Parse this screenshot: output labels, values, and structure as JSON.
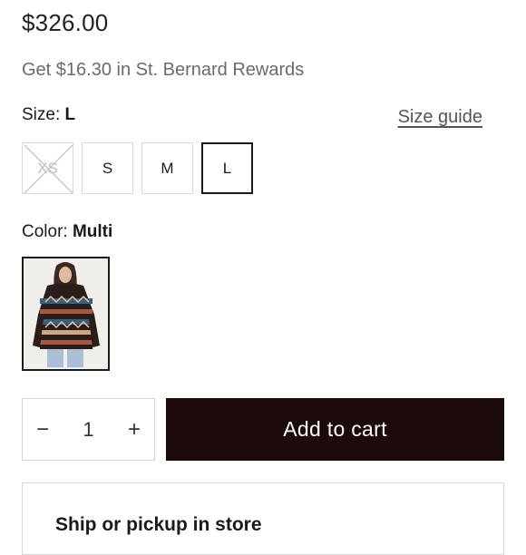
{
  "product": {
    "price": "$326.00",
    "rewards_text": "Get $16.30 in St. Bernard Rewards"
  },
  "size": {
    "label": "Size: ",
    "selected": "L",
    "guide_label": "Size guide",
    "options": [
      {
        "label": "XS",
        "available": false,
        "selected": false
      },
      {
        "label": "S",
        "available": true,
        "selected": false
      },
      {
        "label": "M",
        "available": true,
        "selected": false
      },
      {
        "label": "L",
        "available": true,
        "selected": true
      }
    ]
  },
  "color": {
    "label": "Color: ",
    "selected": "Multi"
  },
  "quantity": {
    "minus_label": "−",
    "value": "1",
    "plus_label": "+"
  },
  "cart": {
    "add_label": "Add to cart"
  },
  "shipping": {
    "title": "Ship or pickup in store"
  },
  "colors": {
    "cart_button_bg": "#1c0a0a",
    "selected_border": "#1a1a1a"
  }
}
